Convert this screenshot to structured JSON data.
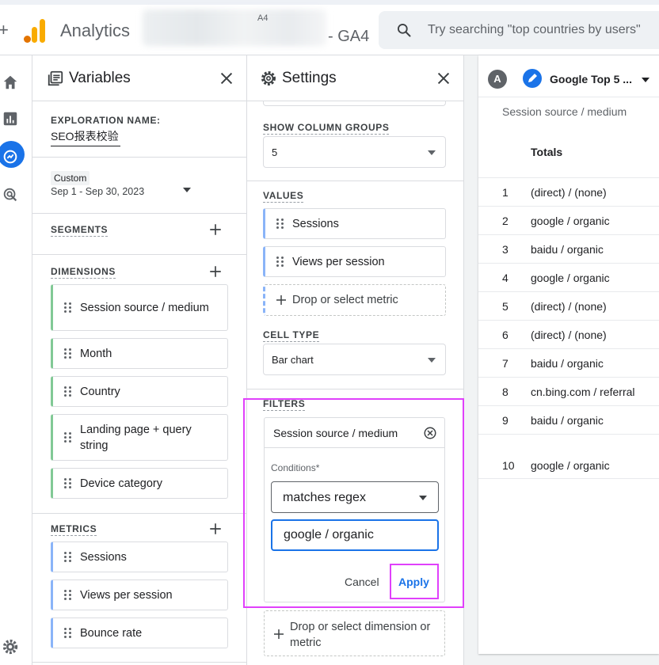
{
  "header": {
    "app_title": "Analytics",
    "property_small": "A4",
    "property_suffix": "- GA4",
    "search_placeholder": "Try searching \"top countries by users\""
  },
  "rail": {
    "items": [
      "home-icon",
      "reports-icon",
      "explore-icon",
      "advertising-icon"
    ],
    "active": "explore-icon",
    "footer": "gear-icon"
  },
  "variables": {
    "title": "Variables",
    "exploration_label": "EXPLORATION NAME:",
    "exploration_name": "SEO报表校验",
    "date_badge": "Custom",
    "date_range": "Sep 1 - Sep 30, 2023",
    "segments_label": "SEGMENTS",
    "dimensions_label": "DIMENSIONS",
    "dimensions": [
      "Session source / medium",
      "Month",
      "Country",
      "Landing page + query string",
      "Device category"
    ],
    "metrics_label": "METRICS",
    "metrics": [
      "Sessions",
      "Views per session",
      "Bounce rate"
    ]
  },
  "settings": {
    "title": "Settings",
    "show_column_groups_label": "SHOW COLUMN GROUPS",
    "show_column_groups_value": "5",
    "values_label": "VALUES",
    "values": [
      "Sessions",
      "Views per session"
    ],
    "drop_metric": "Drop or select metric",
    "cell_type_label": "CELL TYPE",
    "cell_type_value": "Bar chart",
    "filters_label": "FILTERS",
    "filter": {
      "dimension": "Session source / medium",
      "conditions_label": "Conditions*",
      "match_type": "matches regex",
      "expression": "google / organic",
      "cancel": "Cancel",
      "apply": "Apply"
    },
    "drop_dimension": "Drop or select dimension or metric"
  },
  "report": {
    "tab_badge": "A",
    "tab_label": "Google Top 5 ...",
    "column_header": "Session source / medium",
    "totals_label": "Totals",
    "rows": [
      {
        "n": "1",
        "v": "(direct) / (none)"
      },
      {
        "n": "2",
        "v": "google / organic"
      },
      {
        "n": "3",
        "v": "baidu / organic"
      },
      {
        "n": "4",
        "v": "google / organic"
      },
      {
        "n": "5",
        "v": "(direct) / (none)"
      },
      {
        "n": "6",
        "v": "(direct) / (none)"
      },
      {
        "n": "7",
        "v": "baidu / organic"
      },
      {
        "n": "8",
        "v": "cn.bing.com / referral"
      },
      {
        "n": "9",
        "v": "baidu / organic"
      },
      {
        "n": "10",
        "v": "google / organic"
      }
    ]
  },
  "colors": {
    "accent": "#1a73e8",
    "highlight": "#e040fb",
    "dimension_bar": "#81c995",
    "metric_bar": "#8ab4f8"
  }
}
